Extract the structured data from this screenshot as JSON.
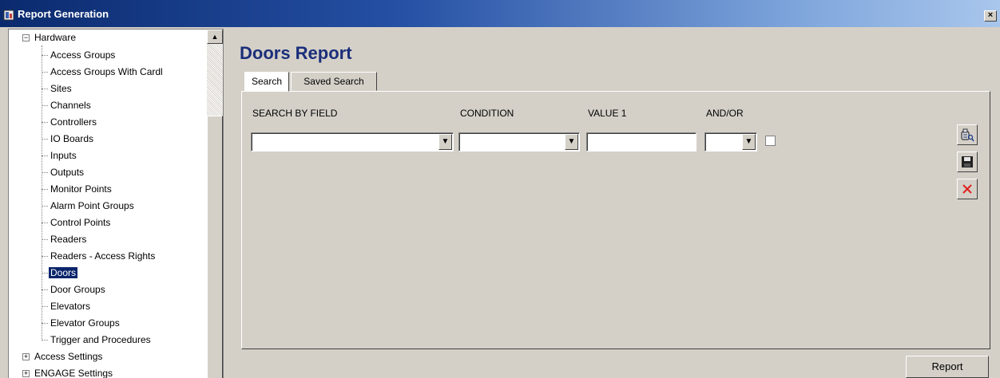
{
  "window": {
    "title": "Report Generation",
    "close_label": "×"
  },
  "tree": {
    "root_label": "Hardware",
    "items": [
      "Access Groups",
      "Access Groups With Cardl",
      "Sites",
      "Channels",
      "Controllers",
      "IO Boards",
      "Inputs",
      "Outputs",
      "Monitor Points",
      "Alarm Point Groups",
      "Control Points",
      "Readers",
      "Readers - Access Rights",
      "Doors",
      "Door Groups",
      "Elevators",
      "Elevator Groups",
      "Trigger and Procedures"
    ],
    "selected": "Doors",
    "siblings": [
      "Access Settings",
      "ENGAGE Settings"
    ],
    "collapse_glyph": "−",
    "expand_glyph": "+"
  },
  "report": {
    "title": "Doors Report",
    "tabs": [
      "Search",
      "Saved Search"
    ],
    "active_tab": "Search",
    "columns": {
      "field": "SEARCH BY FIELD",
      "condition": "CONDITION",
      "value1": "VALUE 1",
      "andor": "AND/OR"
    },
    "inputs": {
      "field": "",
      "condition": "",
      "value1": "",
      "andor": ""
    },
    "report_button": "Report"
  },
  "icons": {
    "search_icon": "search-icon",
    "save_icon": "save-icon",
    "delete_icon": "delete-icon",
    "dropdown_glyph": "▼",
    "scroll_up_glyph": "▲"
  }
}
